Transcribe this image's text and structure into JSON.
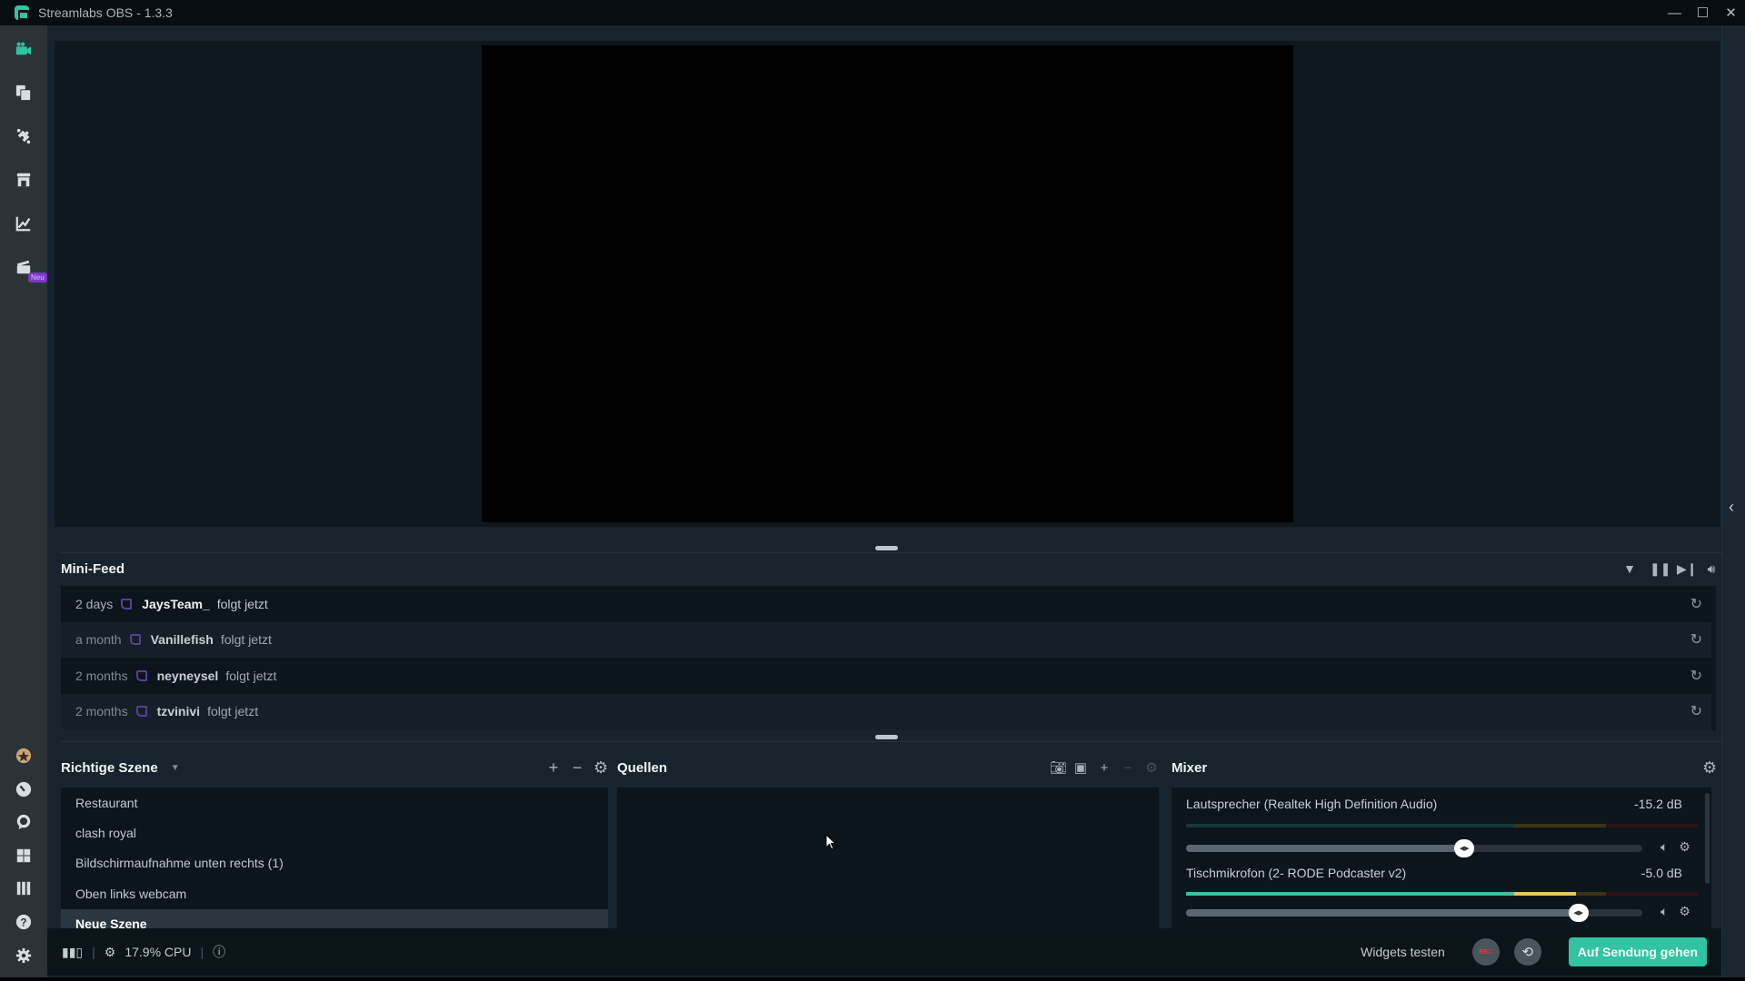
{
  "window": {
    "title": "Streamlabs OBS - 1.3.3",
    "controls": {
      "minimize": "—",
      "maximize": "☐",
      "close": "✕"
    }
  },
  "sidebar": {
    "top_items": [
      {
        "name": "editor",
        "icon": "video-camera-icon",
        "active": true
      },
      {
        "name": "themes",
        "icon": "copy-layers-icon"
      },
      {
        "name": "app-store",
        "icon": "puzzle-icon"
      },
      {
        "name": "store",
        "icon": "storefront-icon"
      },
      {
        "name": "dashboard",
        "icon": "chart-line-icon"
      },
      {
        "name": "highlighter",
        "icon": "clapperboard-icon",
        "badge": "Neu"
      }
    ],
    "bottom_items": [
      {
        "name": "prime",
        "icon": "star-badge-icon"
      },
      {
        "name": "dashboard-dial",
        "icon": "gauge-icon"
      },
      {
        "name": "chat",
        "icon": "chat-bubble-icon"
      },
      {
        "name": "layout",
        "icon": "grid-icon"
      },
      {
        "name": "studio-mode",
        "icon": "columns-icon"
      },
      {
        "name": "help",
        "icon": "help-icon"
      },
      {
        "name": "settings",
        "icon": "gear-icon"
      }
    ],
    "accent": "#31c3a2"
  },
  "minifeed": {
    "title": "Mini-Feed",
    "controls": [
      "filter-icon",
      "pause-icon",
      "skip-icon",
      "volume-icon"
    ],
    "items": [
      {
        "time": "2 days",
        "user": "JaysTeam_",
        "action": "folgt jetzt"
      },
      {
        "time": "a month",
        "user": "Vanillefish",
        "action": "folgt jetzt"
      },
      {
        "time": "2 months",
        "user": "neyneysel",
        "action": "folgt jetzt"
      },
      {
        "time": "2 months",
        "user": "tzvinivi",
        "action": "folgt jetzt"
      }
    ]
  },
  "scenes": {
    "collection": "Richtige Szene",
    "items": [
      {
        "label": "Restaurant"
      },
      {
        "label": "clash royal"
      },
      {
        "label": "Bildschirmaufnahme unten rechts (1)"
      },
      {
        "label": "Oben links webcam"
      },
      {
        "label": "Neue Szene",
        "active": true
      }
    ]
  },
  "sources": {
    "title": "Quellen",
    "items": []
  },
  "mixer": {
    "title": "Mixer",
    "channels": [
      {
        "name": "Lautsprecher (Realtek High Definition Audio)",
        "db": "-15.2 dB",
        "volume_fraction": 0.61,
        "meter_level": 0.0
      },
      {
        "name": "Tischmikrofon (2- RODE Podcaster v2)",
        "db": "-5.0 dB",
        "volume_fraction": 0.86,
        "meter_level": 0.83
      }
    ]
  },
  "footer": {
    "cpu": "17.9% CPU",
    "widgets_test": "Widgets testen",
    "rec_label": "REC",
    "go_live": "Auf Sendung gehen",
    "go_live_color": "#31c3a2"
  }
}
